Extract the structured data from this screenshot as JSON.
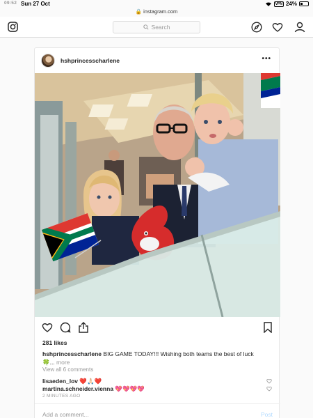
{
  "status_bar": {
    "time": "09:52",
    "date": "Sun 27 Oct",
    "url": "instagram.com",
    "vpn": "VPN",
    "battery": "24%"
  },
  "nav": {
    "search_placeholder": "Search",
    "icons": [
      "instagram-logo",
      "compass-icon",
      "heart-icon",
      "profile-icon"
    ]
  },
  "post": {
    "username": "hshprincesscharlene",
    "more": "•••",
    "likes": "281 likes",
    "caption_user": "hshprincesscharlene",
    "caption_text": " BIG GAME TODAY!!! Wishing both teams the best of luck",
    "caption_line2": "🍀... ",
    "more_link": "more",
    "view_all": "View all 6 comments",
    "comments": [
      {
        "user": "lisaeden_lov",
        "text": " ❤️🙏🏻❤️"
      },
      {
        "user": "martina.schneider.vienna",
        "text": " 💖💖💖💖"
      }
    ],
    "timestamp": "2 MINUTES AGO",
    "add_comment_placeholder": "Add a comment...",
    "post_button": "Post"
  },
  "colors": {
    "flag_green": "#007a4d",
    "flag_gold": "#ffb612",
    "flag_red": "#de3831",
    "flag_blue": "#002395",
    "post_button": "#b3dbff"
  }
}
